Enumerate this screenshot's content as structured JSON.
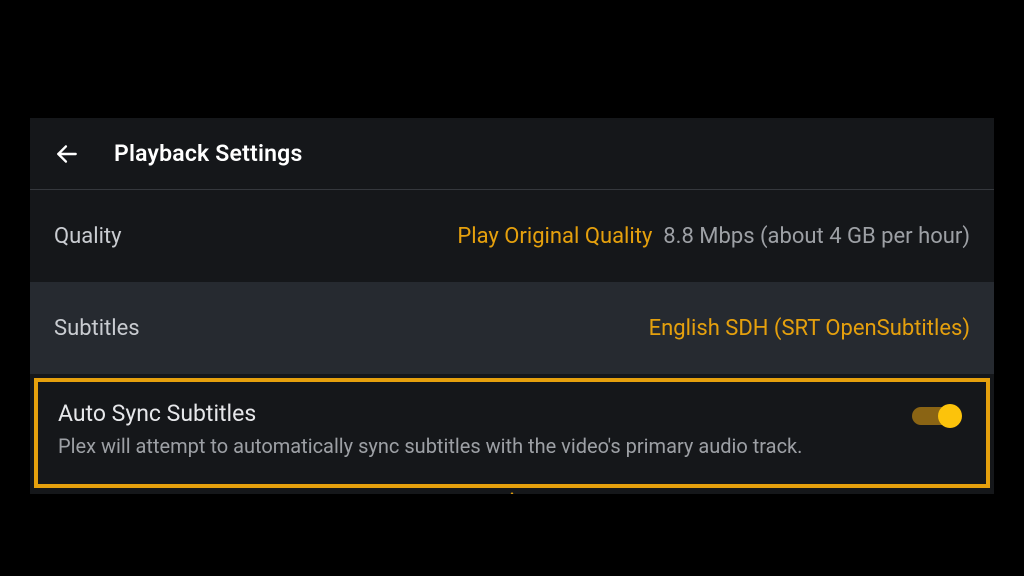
{
  "colors": {
    "accent": "#e5a00d",
    "thumb": "#fcc30b"
  },
  "header": {
    "title": "Playback Settings"
  },
  "rows": {
    "quality": {
      "label": "Quality",
      "value_accent": "Play Original Quality",
      "value_muted": "8.8 Mbps (about 4 GB per hour)"
    },
    "subtitles": {
      "label": "Subtitles",
      "value_accent": "English SDH (SRT OpenSubtitles)"
    },
    "autosync": {
      "title": "Auto Sync Subtitles",
      "description": "Plex will attempt to automatically sync subtitles with the video's primary audio track.",
      "enabled": true
    }
  }
}
